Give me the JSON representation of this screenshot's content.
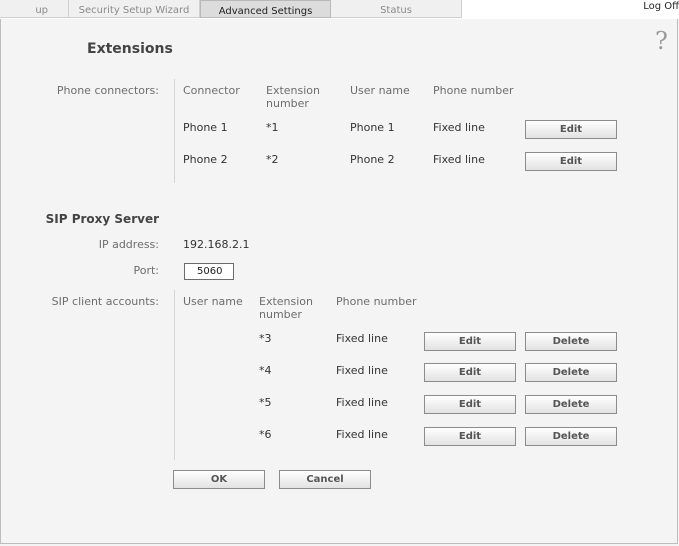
{
  "tabs": [
    {
      "label": "up Wizard",
      "active": false
    },
    {
      "label": "Security Setup Wizard",
      "active": false
    },
    {
      "label": "Advanced Settings",
      "active": true
    },
    {
      "label": "Status",
      "active": false
    }
  ],
  "logoff_label": "Log Off",
  "help_glyph": "?",
  "page_title": "Extensions",
  "phone_connectors": {
    "label": "Phone connectors:",
    "headers": {
      "connector": "Connector",
      "extension": "Extension number",
      "username": "User name",
      "phone": "Phone number"
    },
    "rows": [
      {
        "connector": "Phone 1",
        "extension": "*1",
        "username": "Phone 1",
        "phone": "Fixed line",
        "edit": "Edit"
      },
      {
        "connector": "Phone 2",
        "extension": "*2",
        "username": "Phone 2",
        "phone": "Fixed line",
        "edit": "Edit"
      }
    ]
  },
  "sip_proxy": {
    "title": "SIP Proxy Server",
    "ip_label": "IP address:",
    "ip_value": "192.168.2.1",
    "port_label": "Port:",
    "port_value": "5060"
  },
  "sip_clients": {
    "label": "SIP client accounts:",
    "headers": {
      "username": "User name",
      "extension": "Extension number",
      "phone": "Phone number"
    },
    "rows": [
      {
        "extension": "*3",
        "phone": "Fixed line",
        "edit": "Edit",
        "delete": "Delete"
      },
      {
        "extension": "*4",
        "phone": "Fixed line",
        "edit": "Edit",
        "delete": "Delete"
      },
      {
        "extension": "*5",
        "phone": "Fixed line",
        "edit": "Edit",
        "delete": "Delete"
      },
      {
        "extension": "*6",
        "phone": "Fixed line",
        "edit": "Edit",
        "delete": "Delete"
      }
    ]
  },
  "buttons": {
    "ok": "OK",
    "cancel": "Cancel"
  }
}
